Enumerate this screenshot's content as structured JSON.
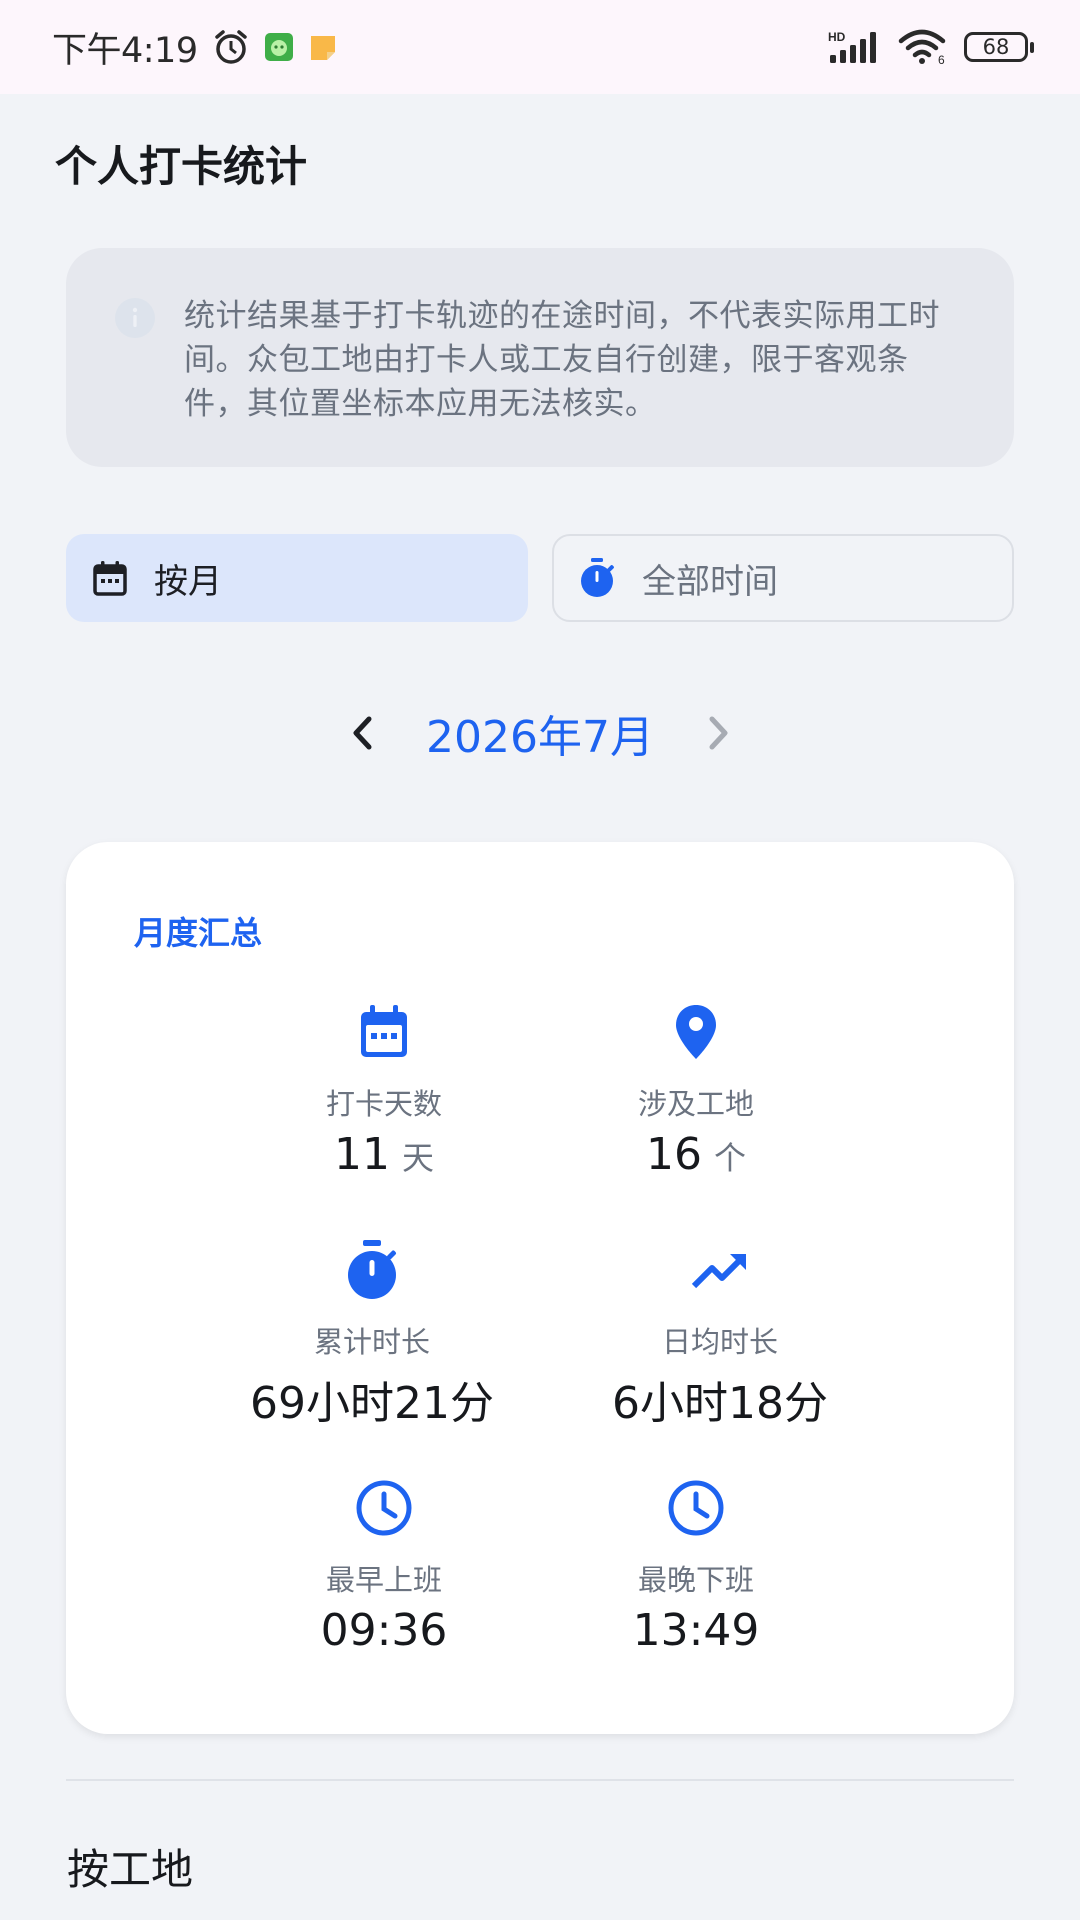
{
  "status_bar": {
    "time": "下午4:19",
    "battery": "68",
    "network": "HD"
  },
  "page": {
    "title": "个人打卡统计"
  },
  "notice": {
    "icon": "info-icon",
    "text": "统计结果基于打卡轨迹的在途时间，不代表实际用工时间。众包工地由打卡人或工友自行创建，限于客观条件，其位置坐标本应用无法核实。"
  },
  "filter": {
    "by_month_label": "按月",
    "all_time_label": "全部时间",
    "selected": "按月"
  },
  "month_nav": {
    "current": "2026年7月"
  },
  "summary": {
    "title": "月度汇总",
    "stats": [
      {
        "icon": "calendar-icon",
        "label": "打卡天数",
        "value": "11",
        "unit": "天"
      },
      {
        "icon": "location-pin-icon",
        "label": "涉及工地",
        "value": "16",
        "unit": "个"
      },
      {
        "icon": "stopwatch-icon",
        "label": "累计时长",
        "value": "69小时21分"
      },
      {
        "icon": "trending-up-icon",
        "label": "日均时长",
        "value": "6小时18分"
      },
      {
        "icon": "clock-icon",
        "label": "最早上班",
        "value": "09:36"
      },
      {
        "icon": "clock-icon",
        "label": "最晚下班",
        "value": "13:49"
      }
    ]
  },
  "section": {
    "by_site_title": "按工地"
  },
  "colors": {
    "accent": "#1e63f0",
    "background": "#f1f3f7",
    "notice_bg": "#e6e8ee",
    "selected_toggle_bg": "#dce6fb"
  }
}
